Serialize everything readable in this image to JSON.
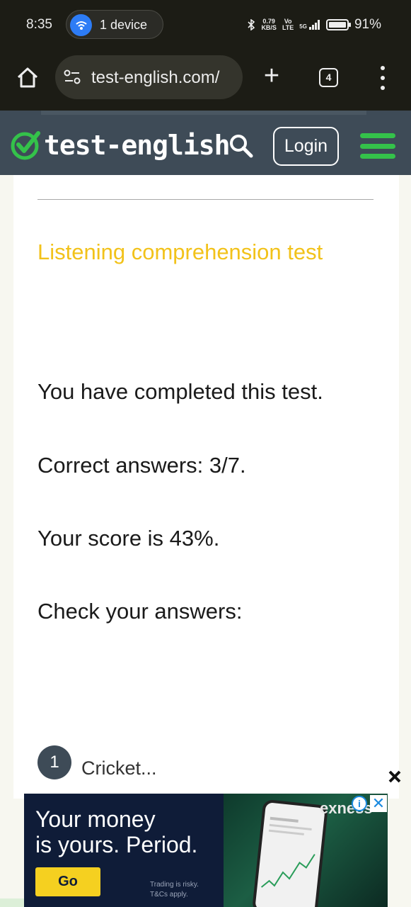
{
  "status_bar": {
    "time": "8:35",
    "pill_text": "1 device",
    "speed_value": "0.79",
    "speed_unit": "KB/S",
    "volte_top": "Vo",
    "volte_bottom": "LTE",
    "network": "5G",
    "battery": "91%"
  },
  "browser": {
    "url": "test-english.com/",
    "tab_count": "4"
  },
  "site_header": {
    "logo_text": "test-english",
    "login_label": "Login",
    "accent_color": "#34c24a",
    "header_color": "#3e4b57"
  },
  "content": {
    "title": "Listening comprehension test",
    "title_color": "#f2c21a",
    "completed": "You have completed this test.",
    "correct": "Correct answers: 3/7.",
    "score": "Your score is 43%.",
    "check": "Check your answers:",
    "question_number": "1",
    "question_text": "Cricket..."
  },
  "ad": {
    "headline_line1": "Your money",
    "headline_line2": "is yours. Period.",
    "cta": "Go",
    "disclaimer_line1": "Trading is risky.",
    "disclaimer_line2": "T&Cs apply.",
    "brand": "exness",
    "info_icon": "i",
    "close_glyph": "✕"
  }
}
